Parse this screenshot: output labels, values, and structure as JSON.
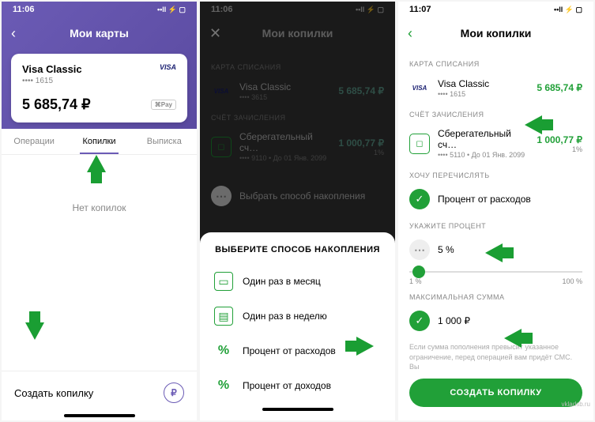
{
  "s1": {
    "time": "11:06",
    "title": "Мои карты",
    "card_name": "Visa Classic",
    "card_brand": "VISA",
    "card_mask": "•••• 1615",
    "balance": "5 685,74 ₽",
    "apay": "⌘Pay",
    "tabs": [
      "Операции",
      "Копилки",
      "Выписка"
    ],
    "empty": "Нет копилок",
    "create": "Создать копилку"
  },
  "s2": {
    "time": "11:06",
    "title": "Мои копилки",
    "sec_debit": "КАРТА СПИСАНИЯ",
    "card_name": "Visa Classic",
    "card_mask": "•••• 3615",
    "card_bal": "5 685,74 ₽",
    "sec_credit": "СЧЁТ ЗАЧИСЛЕНИЯ",
    "acct_name": "Сберегательный сч…",
    "acct_sub": "•••• 9110 • До 01 Янв. 2099",
    "acct_bal": "1 000,77 ₽",
    "acct_pct": "1%",
    "choose": "Выбрать способ накопления",
    "sheet_title": "ВЫБЕРИТЕ СПОСОБ НАКОПЛЕНИЯ",
    "opts": [
      "Один раз в месяц",
      "Один раз в неделю",
      "Процент от расходов",
      "Процент от доходов"
    ]
  },
  "s3": {
    "time": "11:07",
    "title": "Мои копилки",
    "sec_debit": "КАРТА СПИСАНИЯ",
    "card_name": "Visa Classic",
    "card_mask": "•••• 1615",
    "card_bal": "5 685,74 ₽",
    "sec_credit": "СЧЁТ ЗАЧИСЛЕНИЯ",
    "acct_name": "Сберегательный сч…",
    "acct_sub": "•••• 5110 • До 01 Янв. 2099",
    "acct_bal": "1 000,77 ₽",
    "acct_pct": "1%",
    "sec_want": "ХОЧУ ПЕРЕЧИСЛЯТЬ",
    "method": "Процент от расходов",
    "sec_pct": "УКАЖИТЕ ПРОЦЕНТ",
    "pct_val": "5 %",
    "slider_min": "1 %",
    "slider_max": "100 %",
    "sec_max": "МАКСИМАЛЬНАЯ СУММА",
    "max_val": "1 000 ₽",
    "hint": "Если сумма пополнения превысит указанное ограничение, перед операцией вам придёт СМС. Вы",
    "cta": "СОЗДАТЬ КОПИЛКУ",
    "watermark": "vkladsb.ru"
  }
}
